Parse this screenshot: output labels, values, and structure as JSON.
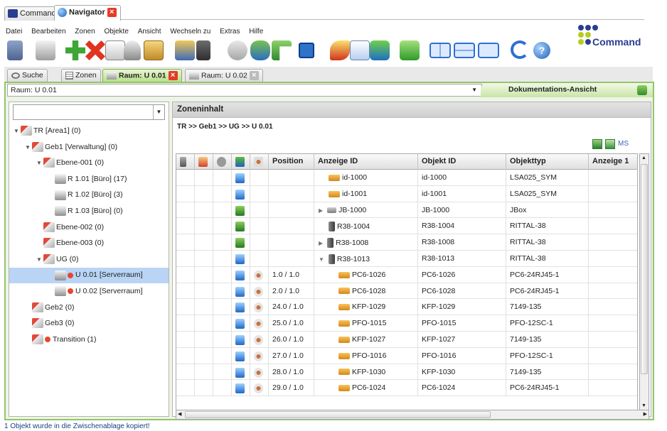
{
  "app_tabs": [
    {
      "label": "Command",
      "active": false
    },
    {
      "label": "Navigator",
      "active": true
    }
  ],
  "menu": [
    "Datei",
    "Bearbeiten",
    "Zonen",
    "Objekte",
    "Ansicht",
    "Wechseln zu",
    "Extras",
    "Hilfe"
  ],
  "logo_text": "Command",
  "sub_tabs": [
    {
      "label": "Suche"
    },
    {
      "label": "Zonen"
    },
    {
      "label": "Raum: U 0.01",
      "active": true
    },
    {
      "label": "Raum: U 0.02"
    }
  ],
  "room_select": "Raum: U 0.01",
  "view_label": "Dokumentations-Ansicht",
  "tree": [
    {
      "label": "TR [Area1] (0)",
      "level": 0,
      "expanded": true
    },
    {
      "label": "Geb1 [Verwaltung] (0)",
      "level": 1,
      "expanded": true
    },
    {
      "label": "Ebene-001 (0)",
      "level": 2,
      "expanded": true
    },
    {
      "label": "R 1.01 [Büro] (17)",
      "level": 3
    },
    {
      "label": "R 1.02 [Büro] (3)",
      "level": 3
    },
    {
      "label": "R 1.03 [Büro] (0)",
      "level": 3
    },
    {
      "label": "Ebene-002 (0)",
      "level": 2
    },
    {
      "label": "Ebene-003 (0)",
      "level": 2
    },
    {
      "label": "UG (0)",
      "level": 2,
      "expanded": true
    },
    {
      "label": "U 0.01 [Serverraum]",
      "level": 3,
      "selected": true,
      "dot": true
    },
    {
      "label": "U 0.02 [Serverraum]",
      "level": 3,
      "dot": true
    },
    {
      "label": "Geb2 (0)",
      "level": 1
    },
    {
      "label": "Geb3 (0)",
      "level": 1
    },
    {
      "label": "Transition (1)",
      "level": 1,
      "dot": true
    }
  ],
  "zone_title": "Zoneninhalt",
  "breadcrumb": "TR >> Geb1 >> UG >> U 0.01",
  "ms_label": "MS",
  "columns": [
    "Position",
    "Anzeige ID",
    "Objekt ID",
    "Objekttyp",
    "Anzeige 1"
  ],
  "rows": [
    {
      "position": "",
      "anzeige": "id-1000",
      "objekt": "id-1000",
      "typ": "LSA025_SYM",
      "icon": "blue",
      "twisty": "",
      "indent": 1
    },
    {
      "position": "",
      "anzeige": "id-1001",
      "objekt": "id-1001",
      "typ": "LSA025_SYM",
      "icon": "blue",
      "twisty": "",
      "indent": 1
    },
    {
      "position": "",
      "anzeige": "JB-1000",
      "objekt": "JB-1000",
      "typ": "JBox",
      "icon": "green",
      "twisty": "▶",
      "indent": 0
    },
    {
      "position": "",
      "anzeige": "R38-1004",
      "objekt": "R38-1004",
      "typ": "RITTAL-38",
      "icon": "green",
      "twisty": "",
      "indent": 0
    },
    {
      "position": "",
      "anzeige": "R38-1008",
      "objekt": "R38-1008",
      "typ": "RITTAL-38",
      "icon": "green",
      "twisty": "▶",
      "indent": 0
    },
    {
      "position": "",
      "anzeige": "R38-1013",
      "objekt": "R38-1013",
      "typ": "RITTAL-38",
      "icon": "blue",
      "twisty": "▼",
      "indent": 0
    },
    {
      "position": "1.0 / 1.0",
      "anzeige": "PC6-1026",
      "objekt": "PC6-1026",
      "typ": "PC6-24RJ45-1",
      "icon": "blue",
      "twisty": "",
      "indent": 2
    },
    {
      "position": "2.0 / 1.0",
      "anzeige": "PC6-1028",
      "objekt": "PC6-1028",
      "typ": "PC6-24RJ45-1",
      "icon": "blue",
      "twisty": "",
      "indent": 2
    },
    {
      "position": "24.0 / 1.0",
      "anzeige": "KFP-1029",
      "objekt": "KFP-1029",
      "typ": "7149-135",
      "icon": "blue",
      "twisty": "",
      "indent": 2
    },
    {
      "position": "25.0 / 1.0",
      "anzeige": "PFO-1015",
      "objekt": "PFO-1015",
      "typ": "PFO-12SC-1",
      "icon": "blue",
      "twisty": "",
      "indent": 2
    },
    {
      "position": "26.0 / 1.0",
      "anzeige": "KFP-1027",
      "objekt": "KFP-1027",
      "typ": "7149-135",
      "icon": "blue",
      "twisty": "",
      "indent": 2
    },
    {
      "position": "27.0 / 1.0",
      "anzeige": "PFO-1016",
      "objekt": "PFO-1016",
      "typ": "PFO-12SC-1",
      "icon": "blue",
      "twisty": "",
      "indent": 2
    },
    {
      "position": "28.0 / 1.0",
      "anzeige": "KFP-1030",
      "objekt": "KFP-1030",
      "typ": "7149-135",
      "icon": "blue",
      "twisty": "",
      "indent": 2
    },
    {
      "position": "29.0 / 1.0",
      "anzeige": "PC6-1024",
      "objekt": "PC6-1024",
      "typ": "PC6-24RJ45-1",
      "icon": "blue",
      "twisty": "",
      "indent": 2
    }
  ],
  "status": "1 Objekt wurde in die Zwischenablage kopiert!"
}
